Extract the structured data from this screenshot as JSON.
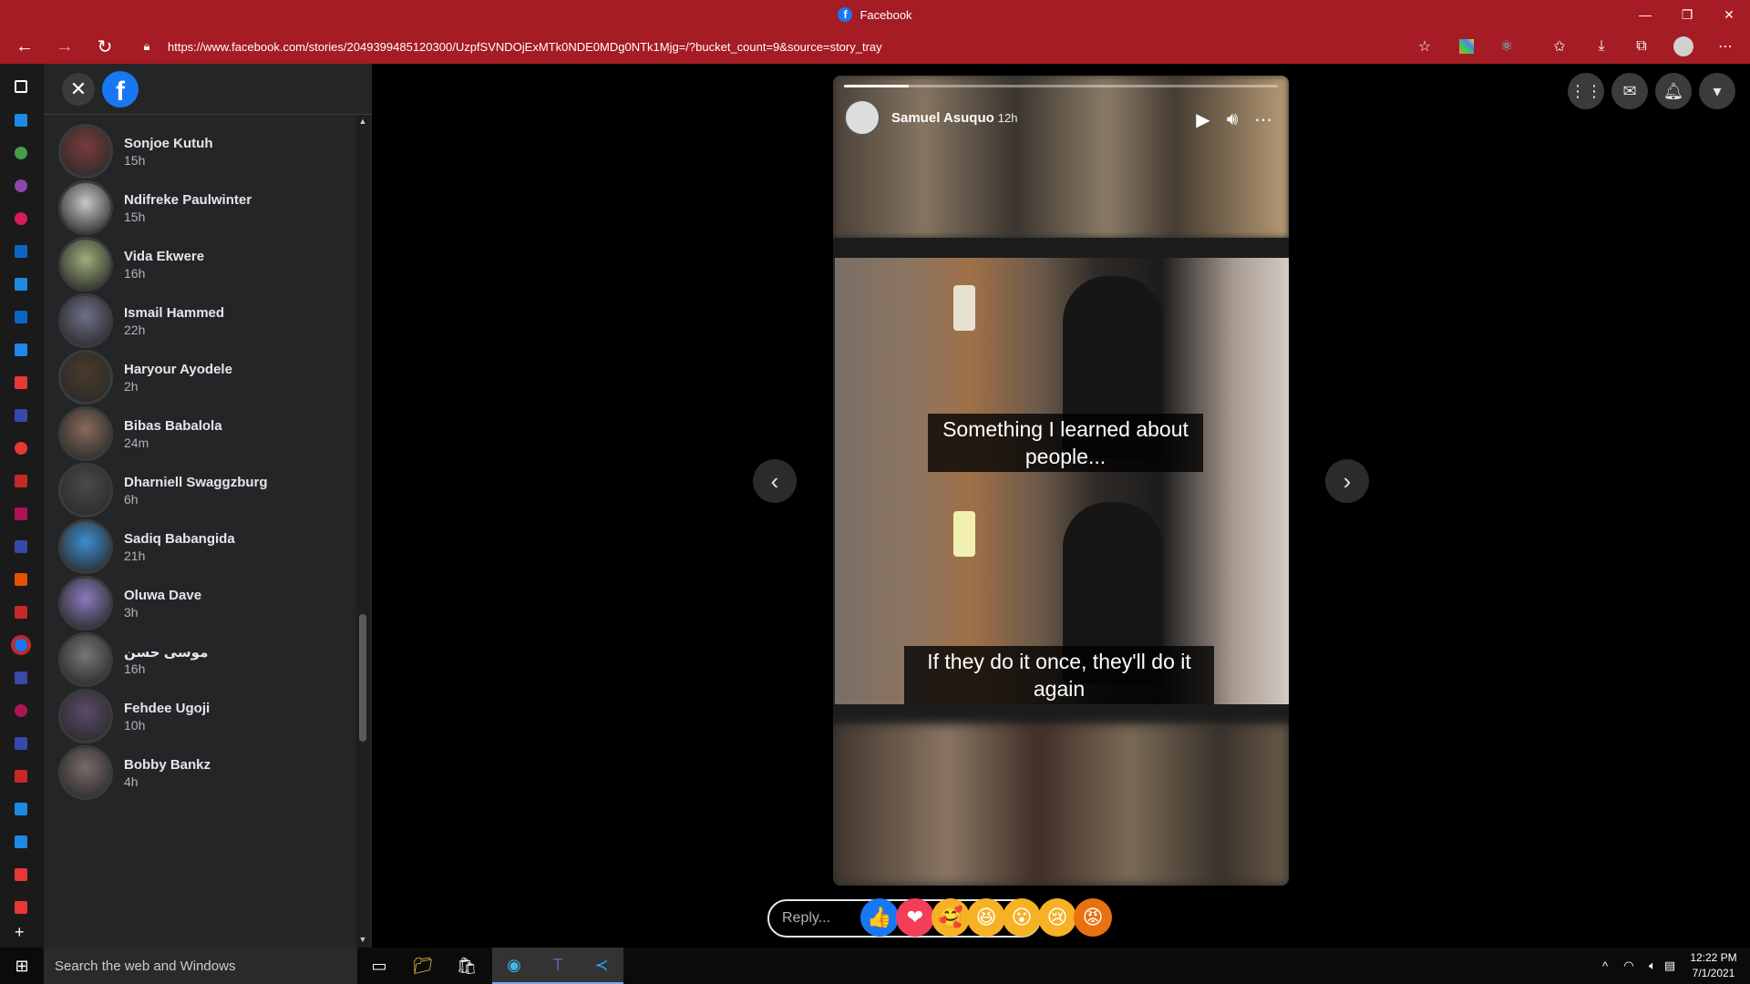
{
  "browser": {
    "title": "Facebook",
    "url": "https://www.facebook.com/stories/2049399485120300/UzpfSVNDOjExMTk0NDE0MDg0NTk1Mjg=/?bucket_count=9&source=story_tray"
  },
  "sidebar": {
    "stories": [
      {
        "name": "Sonjoe Kutuh",
        "time": "15h",
        "color": "#7a3b3b"
      },
      {
        "name": "Ndifreke Paulwinter",
        "time": "15h",
        "color": "#c9c9c9"
      },
      {
        "name": "Vida Ekwere",
        "time": "16h",
        "color": "#9fae7a"
      },
      {
        "name": "Ismail Hammed",
        "time": "22h",
        "color": "#6e6e8a"
      },
      {
        "name": "Haryour Ayodele",
        "time": "2h",
        "color": "#4a3a2a"
      },
      {
        "name": "Bibas Babalola",
        "time": "24m",
        "color": "#8a6a5a"
      },
      {
        "name": "Dharniell Swaggzburg",
        "time": "6h",
        "color": "#4a4a4a"
      },
      {
        "name": "Sadiq Babangida",
        "time": "21h",
        "color": "#3b8ed0"
      },
      {
        "name": "Oluwa Dave",
        "time": "3h",
        "color": "#8a7ac0"
      },
      {
        "name": "موسى حسن",
        "time": "16h",
        "color": "#777777"
      },
      {
        "name": "Fehdee Ugoji",
        "time": "10h",
        "color": "#5a4a6a"
      },
      {
        "name": "Bobby Bankz",
        "time": "4h",
        "color": "#7a6a6a"
      }
    ]
  },
  "story": {
    "author": "Samuel Asuquo",
    "age": "12h",
    "progress": 0.15,
    "caption_top": "Something I learned about people...",
    "caption_bottom": "If they do it once, they'll do it again"
  },
  "reply": {
    "placeholder": "Reply..."
  },
  "reactions": [
    {
      "name": "like",
      "glyph": "👍",
      "color": "#1877f2"
    },
    {
      "name": "love",
      "glyph": "❤",
      "color": "#f33e58"
    },
    {
      "name": "care",
      "glyph": "🥰",
      "color": "#f7b125"
    },
    {
      "name": "haha",
      "glyph": "😆",
      "color": "#f7b125"
    },
    {
      "name": "wow",
      "glyph": "😮",
      "color": "#f7b125"
    },
    {
      "name": "sad",
      "glyph": "😢",
      "color": "#f7b125"
    },
    {
      "name": "angry",
      "glyph": "😡",
      "color": "#e9710f"
    }
  ],
  "taskbar": {
    "search_placeholder": "Search the web and Windows",
    "time": "12:22 PM",
    "date": "7/1/2021"
  },
  "colors": {
    "browser_chrome": "#a51c24",
    "sidebar_bg": "#242526",
    "facebook_blue": "#1877f2"
  }
}
